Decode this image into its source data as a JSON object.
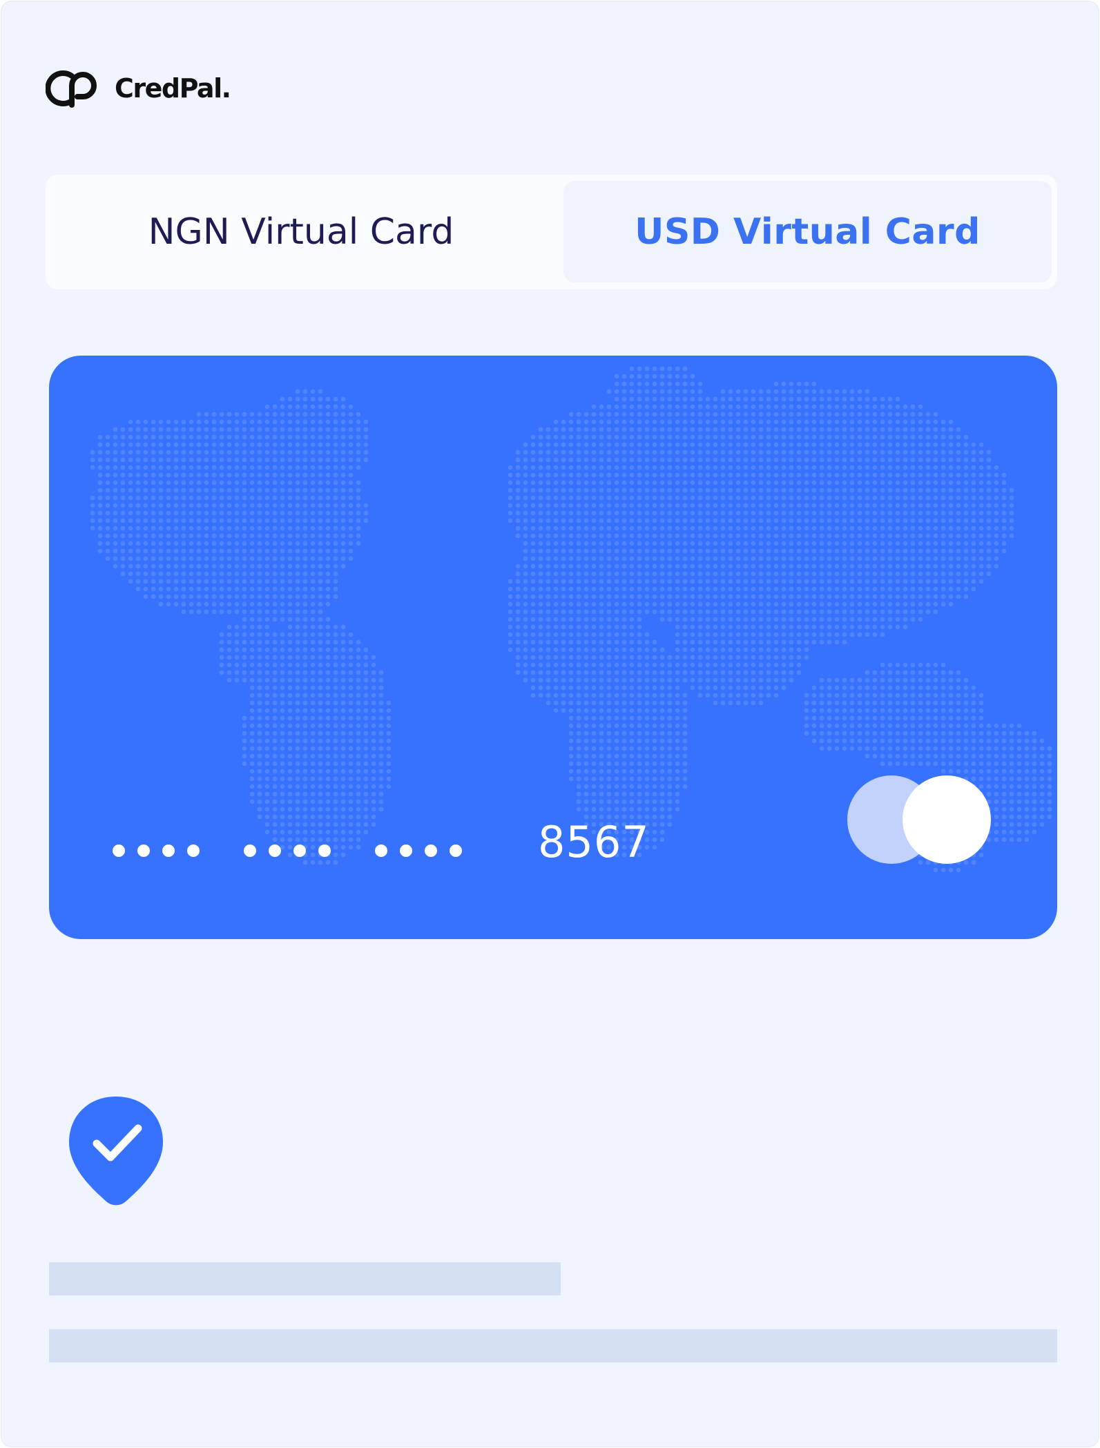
{
  "brand": {
    "name": "CredPal.",
    "logo_icon": "credpal-logo-icon"
  },
  "tabs": [
    {
      "label": "NGN Virtual Card",
      "active": false
    },
    {
      "label": "USD Virtual Card",
      "active": true
    }
  ],
  "card": {
    "masked_groups": [
      "••••",
      "••••",
      "••••"
    ],
    "last4": "8567",
    "background_color": "#3772fe",
    "pattern": "dotted-world-map",
    "network_icon": "card-network-circles-icon"
  },
  "status": {
    "icon": "verified-shield-check-icon",
    "color": "#3772fe"
  },
  "placeholders": {
    "color": "#d5e0f3"
  }
}
